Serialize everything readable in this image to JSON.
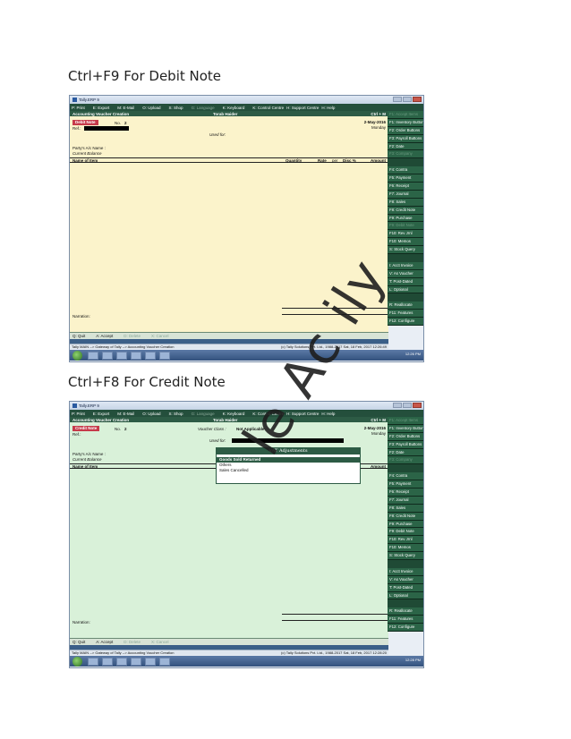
{
  "headings": {
    "debit": "Ctrl+F9 For Debit Note",
    "credit": "Ctrl+F8 For Credit Note"
  },
  "window": {
    "title": "Tally.ERP 9",
    "menu": [
      "P: Print",
      "E: Export",
      "M: E-Mail",
      "O: Upload",
      "S: Shop",
      "G: Language",
      "K: Keyboard",
      "K: Control Centre",
      "H: Support Centre",
      "H: Help"
    ],
    "header": {
      "left": "Accounting Voucher Creation",
      "mid": "Torab Haider",
      "right": "Ctrl + M"
    }
  },
  "debit": {
    "badge": "Debit Note",
    "no_label": "No.",
    "no_value": "2",
    "ref_label": "Ref.:",
    "date": "2-May-2016",
    "day": "Monday",
    "used_for": "Used for:",
    "party_label": "Party's A/c Name :",
    "balance_label": "Current Balance"
  },
  "credit": {
    "badge": "Credit Note",
    "no_label": "No.",
    "no_value": "2",
    "ref_label": "Ref.:",
    "voucher_class_label": "Voucher Class :",
    "voucher_class_value": "Not Applicable",
    "date": "2-May-2016",
    "day": "Monday",
    "used_for": "Used for:",
    "party_label": "Party's A/c Name :",
    "balance_label": "Current Balance",
    "popup": {
      "title": "VAT Adjustments",
      "items": [
        "Goods Sold Returned",
        "Others",
        "Sales Cancelled"
      ]
    }
  },
  "columns": {
    "name": "Name of Item",
    "qty": "Quantity",
    "rate": "Rate",
    "per": "per",
    "disc": "Disc %",
    "amount": "Amount"
  },
  "narration": "Narration:",
  "bottom": [
    "Q: Quit",
    "A: Accept",
    "D: Delete",
    "X: Cancel"
  ],
  "statusbar": {
    "path": "Tally MAIN --> Gateway of Tally --> Accounting Voucher Creation",
    "debit_right": "(c) Tally Solutions Pvt. Ltd., 1988-2017   Sat, 18 Feb, 2017 12:26:49",
    "credit_right": "(c) Tally Solutions Pvt. Ltd., 1988-2017   Sat, 18 Feb, 2017 12:28:20"
  },
  "sidebar": [
    "F1: Accept Items",
    "F1: Inventory Buttons",
    "F2: Order Buttons",
    "F3: Payroll Buttons",
    "F2: Date",
    "F3: Company",
    "",
    "F4: Contra",
    "F5: Payment",
    "F6: Receipt",
    "F7: Journal",
    "F8: Sales",
    "F8: Credit Note",
    "F9: Purchase",
    "F9: Debit Note",
    "F10: Rev Jrnl",
    "F10: Memos",
    "S: Stock Query",
    "",
    "I: Acct Invoice",
    "V: As Voucher",
    "T: Post-Dated",
    "L: Optional",
    "",
    "R: Reallocate",
    "F11: Features",
    "F12: Configure"
  ],
  "sidebar_dim_debit": [
    0,
    5,
    14
  ],
  "sidebar_dim_credit": [
    0,
    5
  ],
  "taskbar_clock": {
    "debit": "12:26 PM",
    "credit": "12:28 PM"
  },
  "watermark": "le Ac   ily"
}
